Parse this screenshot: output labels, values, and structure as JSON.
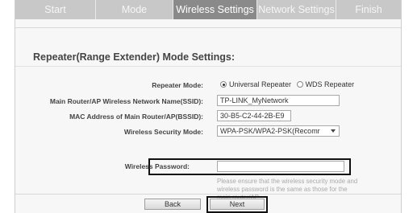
{
  "tabs": [
    {
      "label": "Start",
      "active": false
    },
    {
      "label": "Mode",
      "active": false
    },
    {
      "label": "Wireless Settings",
      "active": true
    },
    {
      "label": "Network Settings",
      "active": false
    },
    {
      "label": "Finish",
      "active": false
    }
  ],
  "section_title": "Repeater(Range Extender) Mode Settings:",
  "form": {
    "repeater_mode_label": "Repeater Mode:",
    "repeater_mode_options": [
      "Universal Repeater",
      "WDS Repeater"
    ],
    "repeater_mode_selected": "Universal Repeater",
    "ssid_label": "Main Router/AP Wireless Network Name(SSID):",
    "ssid_value": "TP-LINK_MyNetwork",
    "bssid_label": "MAC Address of Main Router/AP(BSSID):",
    "bssid_value": "30-B5-C2-44-2B-E9",
    "security_label": "Wireless Security Mode:",
    "security_value": "WPA-PSK/WPA2-PSK(Recomr",
    "password_label": "Wireless Password:",
    "password_value": "",
    "hint": "Please ensure that the wireless security mode and wireless password is the same as those for the main router/AP."
  },
  "buttons": {
    "back": "Back",
    "next": "Next"
  },
  "colors": {
    "tab_bar": "#c8c8c8",
    "active_tab": "#8a8a8a",
    "highlight_border": "#111111"
  }
}
